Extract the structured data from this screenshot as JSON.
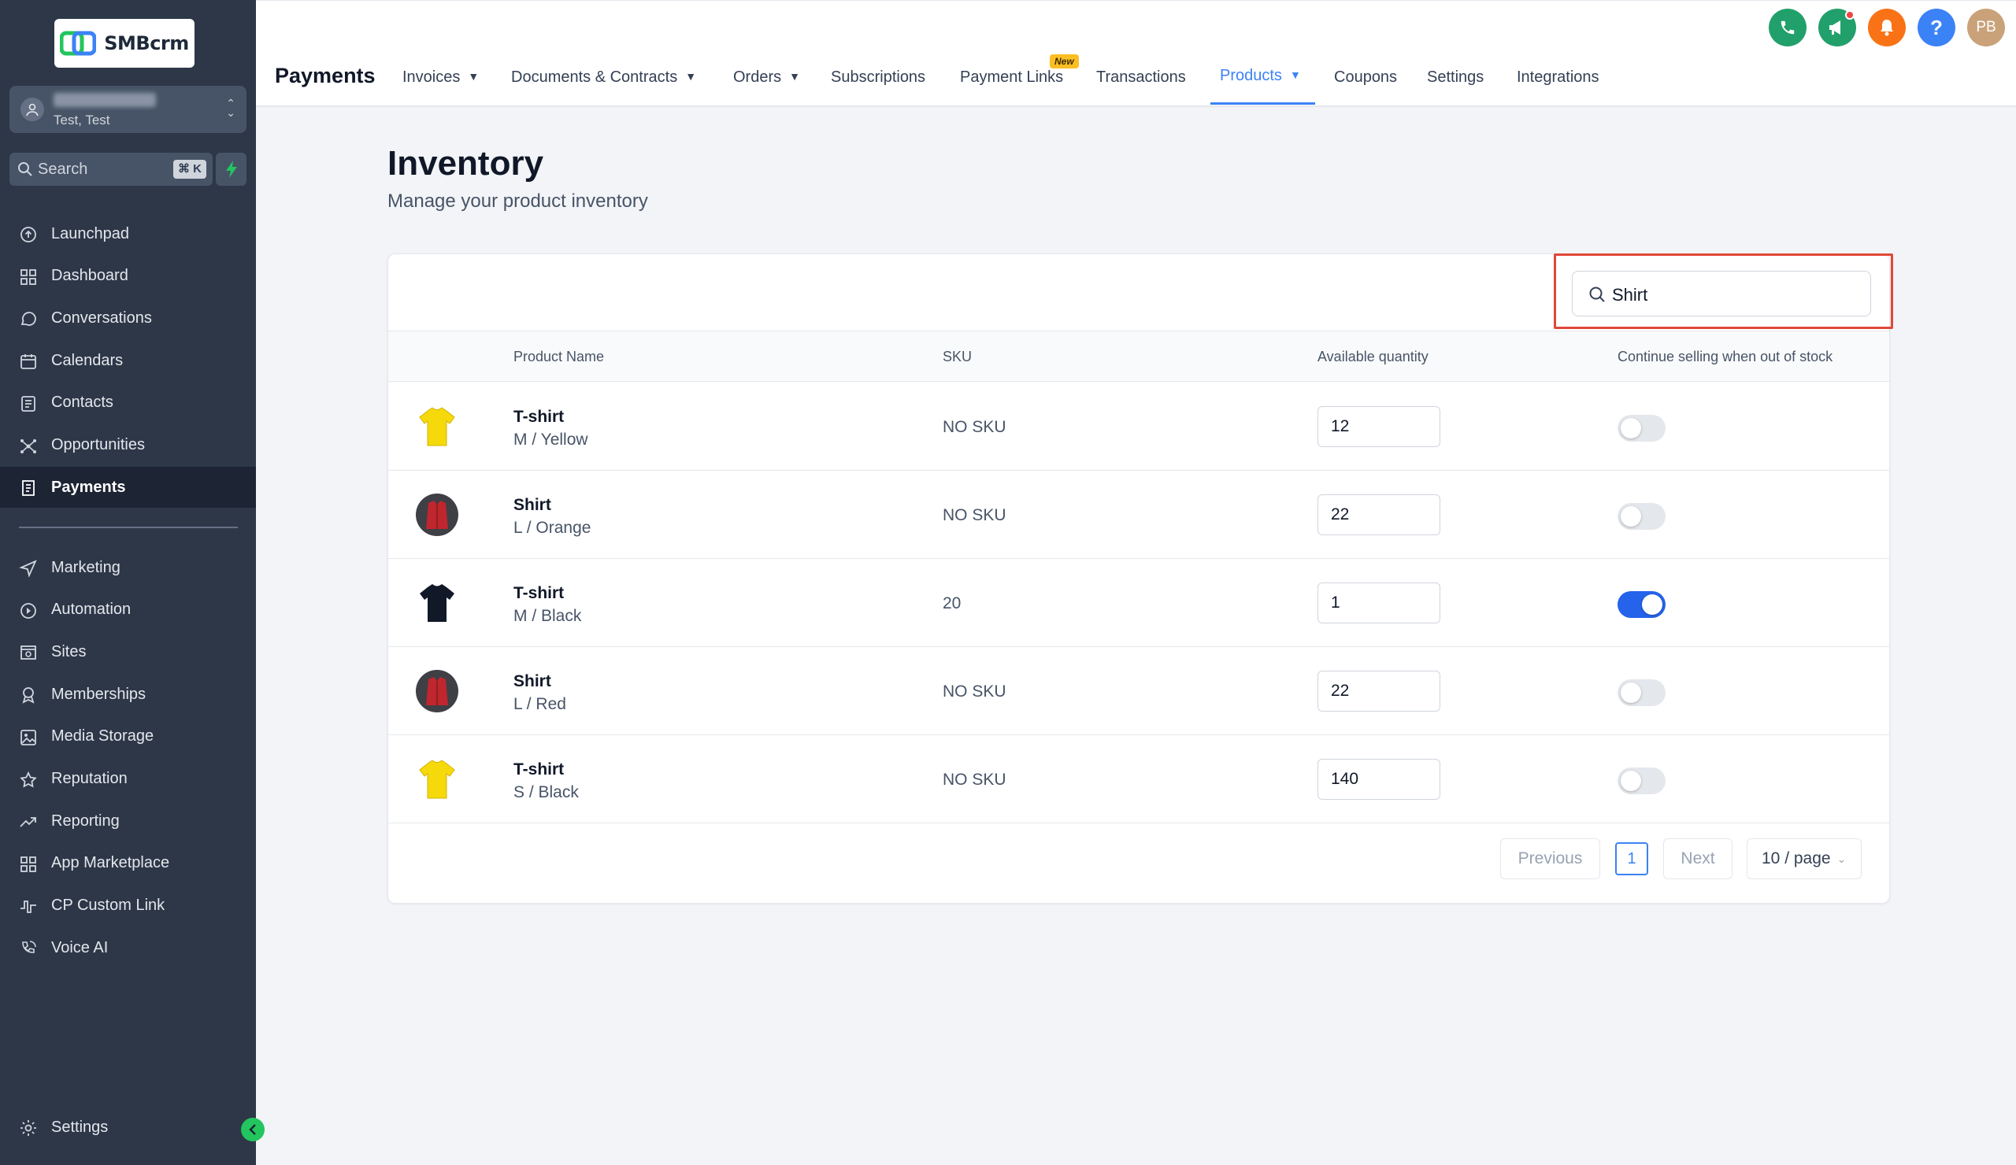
{
  "brand": {
    "name": "SMBcrm"
  },
  "account": {
    "subtitle": "Test, Test"
  },
  "sidebar_search": {
    "label": "Search",
    "shortcut": "⌘ K"
  },
  "nav": [
    {
      "label": "Launchpad",
      "icon": "launchpad-icon"
    },
    {
      "label": "Dashboard",
      "icon": "dashboard-icon"
    },
    {
      "label": "Conversations",
      "icon": "chat-icon"
    },
    {
      "label": "Calendars",
      "icon": "calendar-icon"
    },
    {
      "label": "Contacts",
      "icon": "contacts-icon"
    },
    {
      "label": "Opportunities",
      "icon": "opportunities-icon"
    },
    {
      "label": "Payments",
      "icon": "payments-icon",
      "active": true
    }
  ],
  "nav2": [
    {
      "label": "Marketing",
      "icon": "send-icon"
    },
    {
      "label": "Automation",
      "icon": "automation-icon"
    },
    {
      "label": "Sites",
      "icon": "sites-icon"
    },
    {
      "label": "Memberships",
      "icon": "memberships-icon"
    },
    {
      "label": "Media Storage",
      "icon": "image-icon"
    },
    {
      "label": "Reputation",
      "icon": "star-icon"
    },
    {
      "label": "Reporting",
      "icon": "trending-icon"
    },
    {
      "label": "App Marketplace",
      "icon": "grid-icon"
    },
    {
      "label": "CP Custom Link",
      "icon": "link-icon"
    },
    {
      "label": "Voice AI",
      "icon": "phone-wave-icon"
    }
  ],
  "settings_label": "Settings",
  "topbar": {
    "module_title": "Payments",
    "tabs": [
      "Invoices",
      "Documents & Contracts",
      "Orders",
      "Subscriptions",
      "Payment Links",
      "Transactions",
      "Products",
      "Coupons",
      "Settings",
      "Integrations"
    ],
    "new_badge": "New",
    "avatar_initials": "PB"
  },
  "page": {
    "title": "Inventory",
    "subtitle": "Manage your product inventory"
  },
  "inventory_search": {
    "value": "Shirt"
  },
  "table": {
    "headers": [
      "Product Name",
      "SKU",
      "Available quantity",
      "Continue selling when out of stock"
    ],
    "rows": [
      {
        "name": "T-shirt",
        "variant": "M / Yellow",
        "sku": "NO SKU",
        "quantity": "12",
        "continue_selling": false,
        "thumb": "yellow-tshirt"
      },
      {
        "name": "Shirt",
        "variant": "L / Orange",
        "sku": "NO SKU",
        "quantity": "22",
        "continue_selling": false,
        "thumb": "red-shirt"
      },
      {
        "name": "T-shirt",
        "variant": "M / Black",
        "sku": "20",
        "quantity": "1",
        "continue_selling": true,
        "thumb": "black-tshirt"
      },
      {
        "name": "Shirt",
        "variant": "L / Red",
        "sku": "NO SKU",
        "quantity": "22",
        "continue_selling": false,
        "thumb": "red-shirt"
      },
      {
        "name": "T-shirt",
        "variant": "S / Black",
        "sku": "NO SKU",
        "quantity": "140",
        "continue_selling": false,
        "thumb": "yellow-tshirt"
      }
    ]
  },
  "pagination": {
    "previous": "Previous",
    "current": "1",
    "next": "Next",
    "page_size": "10 / page"
  },
  "colors": {
    "sidebar": "#2d3748",
    "accent": "#3b82f6",
    "toggle_on": "#2563eb",
    "highlight": "#e0483a"
  }
}
